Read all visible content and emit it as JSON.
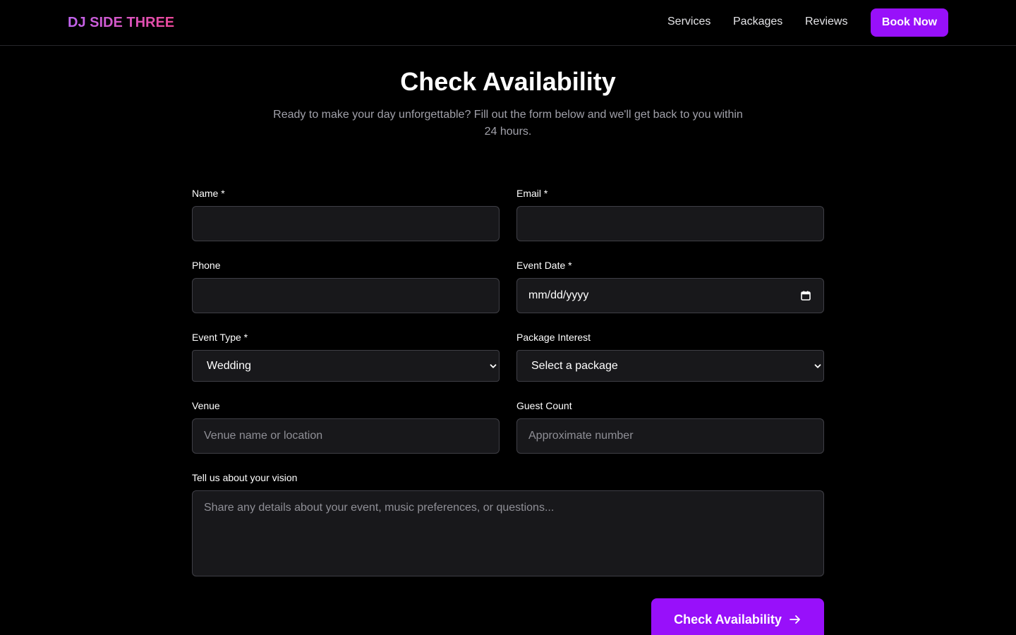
{
  "brand": {
    "logo": "DJ SIDE THREE"
  },
  "nav": {
    "links": [
      "Services",
      "Packages",
      "Reviews"
    ],
    "cta": "Book Now"
  },
  "hero": {
    "title": "Check Availability",
    "subtitle": "Ready to make your day unforgettable? Fill out the form below and we'll get back to you within 24 hours."
  },
  "form": {
    "name": {
      "label": "Name *",
      "value": ""
    },
    "email": {
      "label": "Email *",
      "value": ""
    },
    "phone": {
      "label": "Phone",
      "value": ""
    },
    "event_date": {
      "label": "Event Date *",
      "placeholder": "mm/dd/yyyy"
    },
    "event_type": {
      "label": "Event Type *",
      "selected": "Wedding"
    },
    "package": {
      "label": "Package Interest",
      "selected": "Select a package"
    },
    "venue": {
      "label": "Venue",
      "placeholder": "Venue name or location"
    },
    "guest_count": {
      "label": "Guest Count",
      "placeholder": "Approximate number"
    },
    "vision": {
      "label": "Tell us about your vision",
      "placeholder": "Share any details about your event, music preferences, or questions..."
    },
    "submit": "Check Availability"
  },
  "colors": {
    "accent": "#9810fa",
    "background": "#000000",
    "field_bg": "#18181b",
    "border": "#3f3f46"
  },
  "icons": {
    "calendar": "calendar-icon",
    "chevron": "chevron-down-icon",
    "arrow": "arrow-right-icon"
  }
}
